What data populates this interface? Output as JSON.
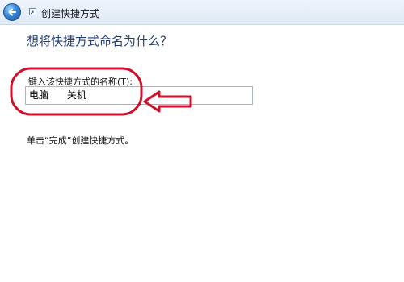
{
  "window": {
    "title": "创建快捷方式"
  },
  "page": {
    "heading": "想将快捷方式命名为什么？",
    "name_field": {
      "label": "键入该快捷方式的名称(T):",
      "value": "电脑      关机"
    },
    "hint": "单击“完成”创建快捷方式。"
  },
  "icons": {
    "back": "back-arrow-icon",
    "shortcut": "shortcut-icon"
  },
  "colors": {
    "heading": "#1f3e7a",
    "annotation": "#d0102a"
  }
}
